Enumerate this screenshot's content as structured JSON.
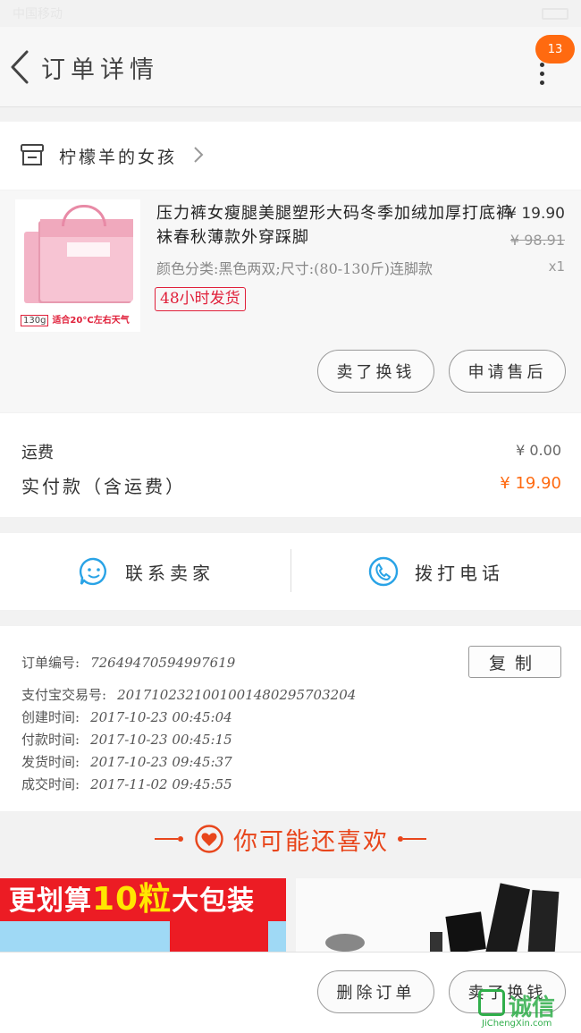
{
  "status_bar": {
    "left_text": "中国移动",
    "time": ""
  },
  "header": {
    "title": "订单详情",
    "badge": "13"
  },
  "shop": {
    "name": "柠檬羊的女孩"
  },
  "product": {
    "title": "压力裤女瘦腿美腿塑形大码冬季加绒加厚打底裤袜春秋薄款外穿踩脚",
    "sku": "颜色分类:黑色两双;尺寸:(80-130斤)连脚款",
    "price": "¥ 19.90",
    "original_price": "¥ 98.91",
    "quantity": "x1",
    "ship_badge": "48小时发货",
    "image_caption_tag": "130g",
    "image_caption": "适合20°C左右天气",
    "buttons": {
      "sell_exchange": "卖了换钱",
      "after_sales": "申请售后"
    }
  },
  "fees": {
    "shipping_label": "运费",
    "shipping_value": "¥ 0.00",
    "paid_label": "实付款（含运费）",
    "paid_value": "¥ 19.90"
  },
  "contact": {
    "seller": "联系卖家",
    "phone": "拨打电话"
  },
  "order_info": {
    "order_no_label": "订单编号:",
    "order_no": "72649470594997619",
    "copy_button": "复制",
    "alipay_label": "支付宝交易号:",
    "alipay_no": "2017102321001001480295703204",
    "created_label": "创建时间:",
    "created": "2017-10-23 00:45:04",
    "paid_label": "付款时间:",
    "paid": "2017-10-23 00:45:15",
    "shipped_label": "发货时间:",
    "shipped": "2017-10-23 09:45:37",
    "closed_label": "成交时间:",
    "closed": "2017-11-02 09:45:55"
  },
  "recommend": {
    "title": "你可能还喜欢",
    "left_banner_a": "更划算",
    "left_banner_b": "10粒",
    "left_banner_c": "大包装"
  },
  "bottom_bar": {
    "delete_order": "删除订单",
    "sell_exchange": "卖了换钱"
  },
  "watermark": {
    "brand": "诚信",
    "url": "JiChengXin.com"
  },
  "colors": {
    "accent": "#ff6a10",
    "recommend_red": "#e8461c",
    "contact_blue": "#29a3e6",
    "badge_red": "#e0203a"
  }
}
